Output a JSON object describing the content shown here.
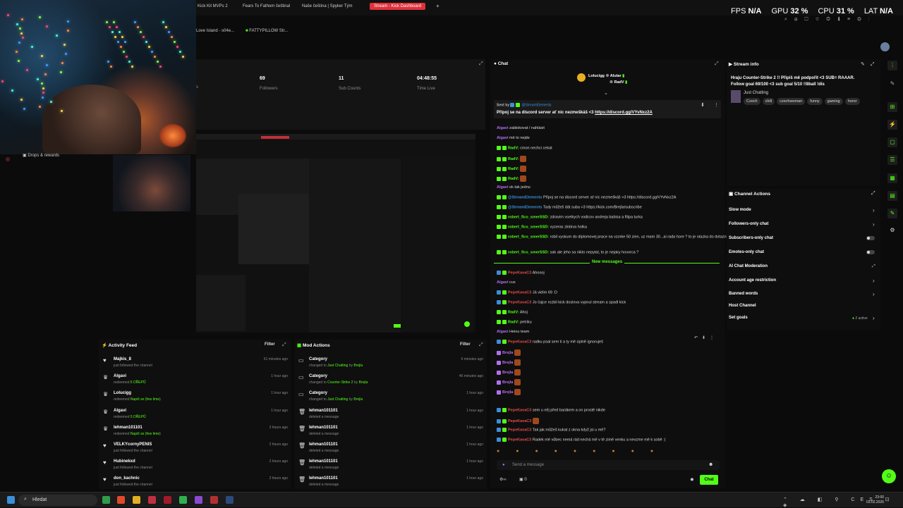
{
  "tabs": [
    {
      "label": "Kick Kit MVPs 2"
    },
    {
      "label": "Fears To Fathom čeština!"
    },
    {
      "label": "Naše čeština | Spyker Tým"
    },
    {
      "label": "Stream - Kick Dashboard"
    }
  ],
  "bookmarks": [
    "Love Island - s04e...",
    "FATTYPILLOW Str..."
  ],
  "perf": {
    "fps_label": "FPS",
    "fps": "N/A",
    "gpu_label": "GPU",
    "gpu": "32 %",
    "cpu_label": "CPU",
    "cpu": "31 %",
    "lat_label": "LAT",
    "lat": "N/A"
  },
  "sidebar": {
    "drops": "Drops & rewards"
  },
  "stats": [
    {
      "value": "69",
      "label": "Followers"
    },
    {
      "value": "11",
      "label": "Sub Counts"
    },
    {
      "value": "04:48:55",
      "label": "Time Live"
    }
  ],
  "activity": {
    "title": "Activity Feed",
    "filter": "Filter",
    "items": [
      {
        "name": "Majkis_8",
        "action": "just followed the channel",
        "time": "51 minutes ago"
      },
      {
        "name": "Algavi",
        "action": "redeemed ",
        "reward": "5 DŘEPŮ",
        "time": "1 hour ago"
      },
      {
        "name": "Lolucigg",
        "action": "redeemed ",
        "reward": "Napiš se (few time)",
        "time": "1 hour ago"
      },
      {
        "name": "Algavi",
        "action": "redeemed ",
        "reward": "5 DŘEPŮ",
        "time": "1 hour ago"
      },
      {
        "name": "lehman101101",
        "action": "redeemed ",
        "reward": "Napiš se (few time)",
        "time": "2 hours ago"
      },
      {
        "name": "VELKYcornyPENIS",
        "action": "just followed the channel",
        "time": "2 hours ago"
      },
      {
        "name": "Hubinekxd",
        "action": "just followed the channel",
        "time": "2 hours ago"
      },
      {
        "name": "don_kachnic",
        "action": "just followed the channel",
        "time": "2 hours ago"
      }
    ]
  },
  "mod": {
    "title": "Mod Actions",
    "filter": "Filter",
    "items": [
      {
        "title": "Category",
        "pre": "changed to ",
        "highlight": "Just Chatting",
        "post": " by ",
        "by": "Brejla",
        "time": "6 minutes ago"
      },
      {
        "title": "Category",
        "pre": "changed to ",
        "highlight": "Counter-Strike 2",
        "post": " by ",
        "by": "Brejla",
        "time": "46 minutes ago"
      },
      {
        "title": "Category",
        "pre": "changed to ",
        "highlight": "Just Chatting",
        "post": " by ",
        "by": "Brejla",
        "time": "1 hour ago"
      },
      {
        "title": "lehman101101",
        "pre": "deleted a message",
        "highlight": "",
        "post": "",
        "by": "",
        "time": "1 hour ago"
      },
      {
        "title": "lehman101101",
        "pre": "deleted a message",
        "highlight": "",
        "post": "",
        "by": "",
        "time": "1 hour ago"
      },
      {
        "title": "lehman101101",
        "pre": "deleted a message",
        "highlight": "",
        "post": "",
        "by": "",
        "time": "1 hour ago"
      },
      {
        "title": "lehman101101",
        "pre": "deleted a message",
        "highlight": "",
        "post": "",
        "by": "",
        "time": "1 hour ago"
      },
      {
        "title": "lehman101101",
        "pre": "deleted a message",
        "highlight": "",
        "post": "",
        "by": "",
        "time": "1 hour ago"
      }
    ]
  },
  "chat": {
    "title": "Chat",
    "top_users": [
      "Lolucigg",
      "Alutar",
      "RadV"
    ],
    "pinned_by": "Sent by",
    "pinned_user": "@StreamElements",
    "pinned_text": "Připoj se na discord server ať nic nezmeškáš <3 ",
    "pinned_link": "https://discord.gg/VYvNxz2A",
    "new_messages": "New messages",
    "lines": [
      {
        "user": "Algavi",
        "text": "zablokovat / nahlásit",
        "color": "purple"
      },
      {
        "user": "Algavi",
        "text": "mě to nejde",
        "color": "purple"
      },
      {
        "user": "RadV:",
        "text": "cmon nechci cekat",
        "color": "green"
      },
      {
        "user": "RadV:",
        "text": "",
        "color": "green"
      },
      {
        "user": "RadV:",
        "text": "",
        "color": "green"
      },
      {
        "user": "RadV:",
        "text": "",
        "color": "green"
      },
      {
        "user": "Algavi",
        "text": "ok tak jednu",
        "color": "purple"
      },
      {
        "user": "@StreamElements",
        "text": "Připoj se na discord server ať nic nezmeškáš <3 https://discord.gg/VYvNxz2A",
        "color": "blue"
      },
      {
        "user": "@StreamElements",
        "text": "Tady můžeš dát suba <3 https://kick.com/Brejla/subscribe",
        "color": "blue"
      },
      {
        "user": "robert_fico_smerSSD:",
        "text": "zdravim vsetkych vodicov andreja babisa a filipa turka",
        "color": "green"
      },
      {
        "user": "robert_fico_smerSSD:",
        "text": "vyzeras zlobiva holka",
        "color": "green"
      },
      {
        "user": "robert_fico_smerSSD:",
        "text": "robil vyskum do diplomovej prace na vzorke 50 zien, uz mam 30...ai rada hore ? to je otazka do dotaznika chapes",
        "color": "green"
      },
      {
        "user": "robert_fico_smerSSD:",
        "text": "sak ale jeho sa nikto nepytal, to je nejaky hovorca ?",
        "color": "green"
      },
      {
        "user": "PepeKavaC3",
        "text": "Ahoooj",
        "color": "red"
      },
      {
        "user": "Algavi",
        "text": "cus",
        "color": "purple"
      },
      {
        "user": "PepeKavaC3",
        "text": "Já vidím 69 :D",
        "color": "red"
      },
      {
        "user": "PepeKavaC3",
        "text": "Jo čajce rozbil kick doslova vypnul stream a spadl kick",
        "color": "red"
      },
      {
        "user": "RadV:",
        "text": "Ahoj",
        "color": "green"
      },
      {
        "user": "RadV:",
        "text": "petriku",
        "color": "green"
      },
      {
        "user": "Algavi",
        "text": "Heiou team",
        "color": "purple"
      },
      {
        "user": "PepeKavaC3",
        "text": "radku psal sem ti a ty mě úplně ignoruješ",
        "color": "red"
      },
      {
        "user": "Brejla",
        "text": "",
        "color": "purple"
      },
      {
        "user": "Brejla",
        "text": "",
        "color": "purple"
      },
      {
        "user": "Brejla",
        "text": "",
        "color": "purple"
      },
      {
        "user": "Brejla",
        "text": "",
        "color": "purple"
      },
      {
        "user": "Brejla",
        "text": "",
        "color": "purple"
      },
      {
        "user": "PepeKavaC3",
        "text": "sem u něj před barákem a on prostě nikde",
        "color": "red"
      },
      {
        "user": "PepeKavaC3",
        "text": "",
        "color": "red"
      },
      {
        "user": "PepeKavaC3",
        "text": "Tak jak můžeš kukat z okna když jsi u mě?",
        "color": "red"
      },
      {
        "user": "PepeKavaC3",
        "text": "Radek mě vůbec nemá rád nechá mě v té zimě venku a nevzme mě k sobě :(",
        "color": "red"
      }
    ],
    "input_placeholder": "Send a message",
    "send_button": "Chat",
    "count": "0"
  },
  "stream_info": {
    "title": "Stream info",
    "stream_title": "Hraju Counter-Strike 2 !! Připiš mě podpořit <3 SUB= RAAAR. Follow goal 69/100 <3 sub goal 5/10 !!8ball !dis",
    "category": "Just Chatting",
    "tags": [
      "Czech",
      "chill",
      "czechwoman",
      "funny",
      "gaming",
      "horor"
    ]
  },
  "channel_actions": {
    "title": "Channel Actions",
    "items": [
      {
        "label": "Slow mode",
        "kind": "chevron"
      },
      {
        "label": "Followers-only chat",
        "kind": "chevron"
      },
      {
        "label": "Subscribers-only chat",
        "kind": "toggle"
      },
      {
        "label": "Emotes-only chat",
        "kind": "toggle"
      },
      {
        "label": "AI Chat Moderation",
        "kind": "icon"
      },
      {
        "label": "Account age restriction",
        "kind": "chevron"
      },
      {
        "label": "Banned words",
        "kind": "chevron"
      },
      {
        "label": "Host Channel",
        "kind": "none"
      },
      {
        "label": "Set goals",
        "kind": "active",
        "status": "2 active"
      }
    ]
  },
  "taskbar": {
    "search": "Hledat",
    "time": "23:00",
    "date": "03.02.2026"
  }
}
